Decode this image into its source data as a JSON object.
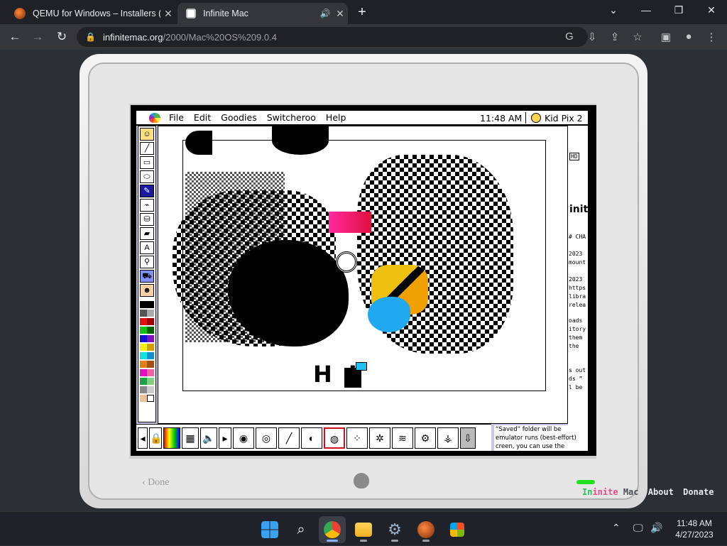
{
  "browser": {
    "tabs": [
      {
        "title": "QEMU for Windows – Installers (6",
        "active": false
      },
      {
        "title": "Infinite Mac",
        "active": true
      }
    ],
    "url_host": "infinitemac.org",
    "url_path": "/2000/Mac%20OS%209.0.4",
    "new_tab": "+",
    "window_controls": [
      "chevron-down-icon",
      "minimize-icon",
      "restore-icon",
      "close-icon"
    ]
  },
  "mac": {
    "menus": [
      "File",
      "Edit",
      "Goodies",
      "Switcheroo",
      "Help"
    ],
    "clock": "11:48 AM",
    "app_name": "Kid Pix 2",
    "canvas_text": "H I",
    "right_peek": {
      "hd": "HD",
      "title_fragment": "inite",
      "lines": [
        "# CHA",
        "2023",
        "mount",
        "2023",
        "https",
        "libra",
        "relea",
        "oads",
        "itory",
        "them",
        "the",
        "s out",
        "ds ”",
        "l be"
      ]
    },
    "bottom_text": [
      "“Saved” folder will be",
      "emulator runs (best-effort)",
      "creen, you can use the"
    ],
    "done_label": "‹ Done"
  },
  "footer": {
    "brand_part1": "In",
    "brand_part2": "inite",
    "brand_part3": "Mac",
    "about": "About",
    "donate": "Donate"
  },
  "taskbar": {
    "apps": [
      "windows-start",
      "search",
      "chrome",
      "file-explorer",
      "settings",
      "qemu",
      "microsoft-store"
    ],
    "time": "11:48 AM",
    "date": "4/27/2023"
  },
  "colors": {
    "accent": "#22c55e",
    "brand_pink": "#e94b8a",
    "palette_selected": "#1a1aa0",
    "tool_selected_border": "#d01020"
  }
}
